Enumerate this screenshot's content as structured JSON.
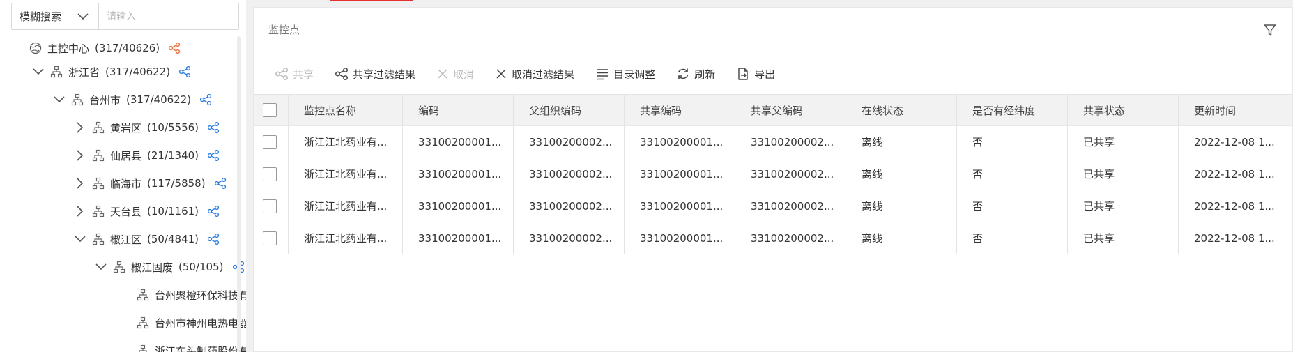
{
  "search": {
    "mode_label": "模糊搜索",
    "placeholder": "请输入"
  },
  "tree": {
    "nodes": [
      {
        "label": "主控中心",
        "count": "(317/40626)"
      },
      {
        "label": "浙江省",
        "count": "(317/40622)"
      },
      {
        "label": "台州市",
        "count": "(317/40622)"
      },
      {
        "label": "黄岩区",
        "count": "(10/5556)"
      },
      {
        "label": "仙居县",
        "count": "(21/1340)"
      },
      {
        "label": "临海市",
        "count": "(117/5858)"
      },
      {
        "label": "天台县",
        "count": "(10/1161)"
      },
      {
        "label": "椒江区",
        "count": "(50/4841)"
      },
      {
        "label": "椒江固废",
        "count": "(50/105)"
      },
      {
        "label": "台州聚橙环保科技有",
        "count": ""
      },
      {
        "label": "台州市神州电热电器",
        "count": ""
      },
      {
        "label": "浙江东头制药股份有",
        "count": ""
      }
    ]
  },
  "panel": {
    "title": "监控点"
  },
  "toolbar": {
    "share": "共享",
    "share_filtered": "共享过滤结果",
    "cancel": "取消",
    "cancel_filtered": "取消过滤结果",
    "catalog_adjust": "目录调整",
    "refresh": "刷新",
    "export": "导出"
  },
  "table": {
    "columns": [
      "监控点名称",
      "编码",
      "父组织编码",
      "共享编码",
      "共享父编码",
      "在线状态",
      "是否有经纬度",
      "共享状态",
      "更新时间"
    ],
    "rows": [
      [
        "浙江江北药业有...",
        "33100200001...",
        "33100200002...",
        "33100200001...",
        "33100200002...",
        "离线",
        "否",
        "已共享",
        "2022-12-08 1..."
      ],
      [
        "浙江江北药业有...",
        "33100200001...",
        "33100200002...",
        "33100200001...",
        "33100200002...",
        "离线",
        "否",
        "已共享",
        "2022-12-08 1..."
      ],
      [
        "浙江江北药业有...",
        "33100200001...",
        "33100200002...",
        "33100200001...",
        "33100200002...",
        "离线",
        "否",
        "已共享",
        "2022-12-08 1..."
      ],
      [
        "浙江江北药业有...",
        "33100200001...",
        "33100200002...",
        "33100200001...",
        "33100200002...",
        "离线",
        "否",
        "已共享",
        "2022-12-08 1..."
      ]
    ]
  },
  "colors": {
    "accent_red": "#e0312f",
    "share_icon_orange": "#f06a3c",
    "share_icon_blue": "#2f7de1"
  }
}
